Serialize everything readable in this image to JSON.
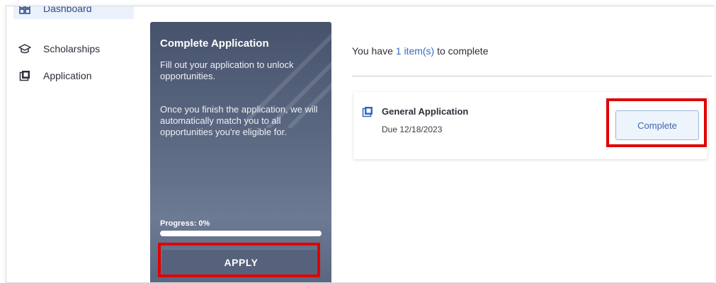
{
  "sidebar": {
    "items": [
      {
        "label": "Dashboard",
        "icon": "dashboard-icon",
        "active": true
      },
      {
        "label": "Scholarships",
        "icon": "graduation-cap-icon",
        "active": false
      },
      {
        "label": "Application",
        "icon": "application-icon",
        "active": false
      }
    ]
  },
  "promo": {
    "title": "Complete Application",
    "text1": "Fill out your application to unlock opportunities.",
    "text2": "Once you finish the application, we will automatically match you to all opportunities you're eligible for.",
    "progress_label": "Progress: 0%",
    "progress_value": 0,
    "apply_label": "APPLY"
  },
  "main": {
    "header_prefix": "You have ",
    "header_count": "1 item(s)",
    "header_suffix": " to complete",
    "task": {
      "title": "General Application",
      "due": "Due 12/18/2023",
      "button_label": "Complete"
    }
  },
  "colors": {
    "accent": "#3469c2",
    "promo_dark": "#47536c",
    "highlight": "#e00000"
  }
}
